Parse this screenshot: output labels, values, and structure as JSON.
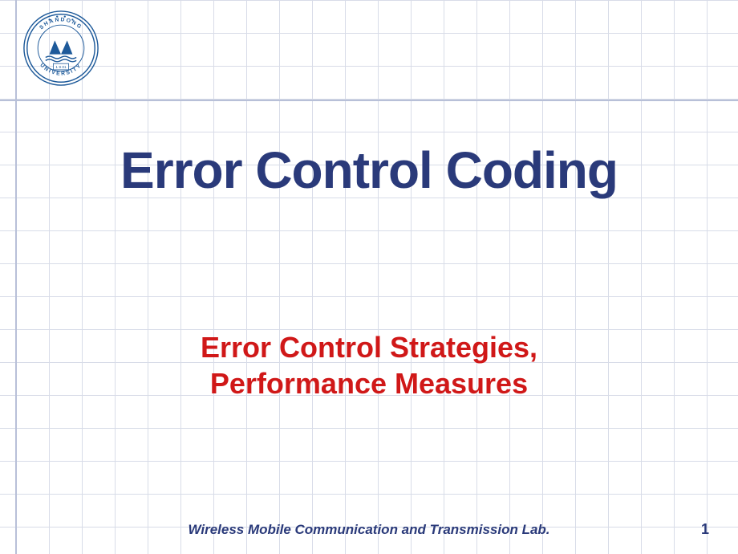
{
  "logo": {
    "institution_top": "SHANDONG",
    "institution_bottom": "UNIVERSITY",
    "year": "1 9 01"
  },
  "title": "Error Control Coding",
  "subtitle_line1": "Error Control Strategies,",
  "subtitle_line2": "Performance Measures",
  "footer": "Wireless Mobile Communication and Transmission Lab.",
  "page_number": "1",
  "colors": {
    "title": "#2a3a7a",
    "subtitle": "#d01818",
    "grid": "#d8dce8",
    "major_grid": "#b8c0d8",
    "logo_blue": "#1e5a9a"
  }
}
